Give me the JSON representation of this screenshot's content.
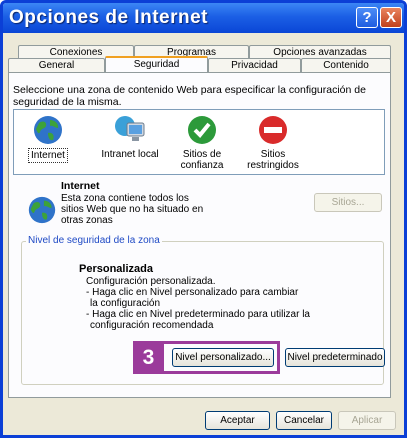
{
  "window": {
    "title": "Opciones de Internet",
    "help_label": "?",
    "close_label": "X"
  },
  "tabs": {
    "row1": [
      "Conexiones",
      "Programas",
      "Opciones avanzadas"
    ],
    "row2": [
      "General",
      "Seguridad",
      "Privacidad",
      "Contenido"
    ],
    "active": "Seguridad"
  },
  "intro_text": "Seleccione una zona de contenido Web para especificar la configuración de seguridad de la misma.",
  "zones": [
    {
      "label": "Internet",
      "icon": "globe-icon",
      "selected": true
    },
    {
      "label": "Intranet local",
      "icon": "intranet-computer-icon",
      "selected": false
    },
    {
      "label": "Sitios de confianza",
      "icon": "trusted-check-icon",
      "selected": false
    },
    {
      "label": "Sitios restringidos",
      "icon": "restricted-no-entry-icon",
      "selected": false
    }
  ],
  "zone_info": {
    "name": "Internet",
    "description": "Esta zona contiene todos los sitios Web que no ha situado en otras zonas",
    "sites_button": "Sitios..."
  },
  "security_level": {
    "group_title": "Nivel de seguridad de la zona",
    "title": "Personalizada",
    "lines": [
      "Configuración personalizada.",
      "- Haga clic en Nivel personalizado para cambiar",
      "  la configuración",
      "- Haga clic en Nivel predeterminado para utilizar la",
      "  configuración recomendada"
    ],
    "custom_button": "Nivel personalizado...",
    "default_button": "Nivel predeterminado"
  },
  "callout": {
    "number": "3",
    "color": "#9b3b9b"
  },
  "footer": {
    "accept": "Aceptar",
    "cancel": "Cancelar",
    "apply": "Aplicar"
  }
}
